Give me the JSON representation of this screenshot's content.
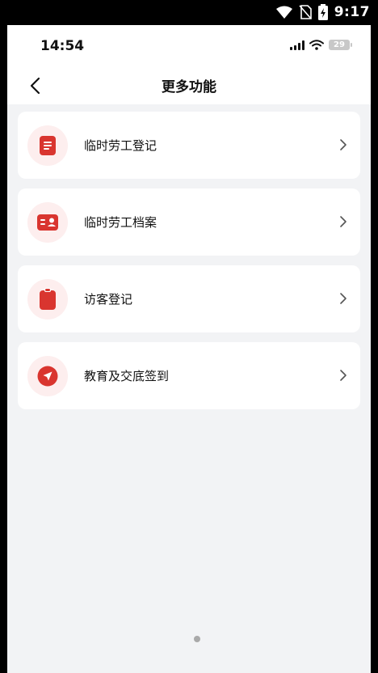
{
  "system_bar": {
    "time": "9:17"
  },
  "status_bar": {
    "time": "14:54",
    "battery": "29"
  },
  "header": {
    "title": "更多功能"
  },
  "menu": {
    "items": [
      {
        "label": "临时劳工登记",
        "icon": "document-icon"
      },
      {
        "label": "临时劳工档案",
        "icon": "id-card-icon"
      },
      {
        "label": "访客登记",
        "icon": "visitor-note-icon"
      },
      {
        "label": "教育及交底签到",
        "icon": "navigation-arrow-icon"
      }
    ]
  },
  "colors": {
    "accent": "#d9352f",
    "icon_bg": "#fdeeee",
    "page_bg": "#f2f3f5"
  }
}
